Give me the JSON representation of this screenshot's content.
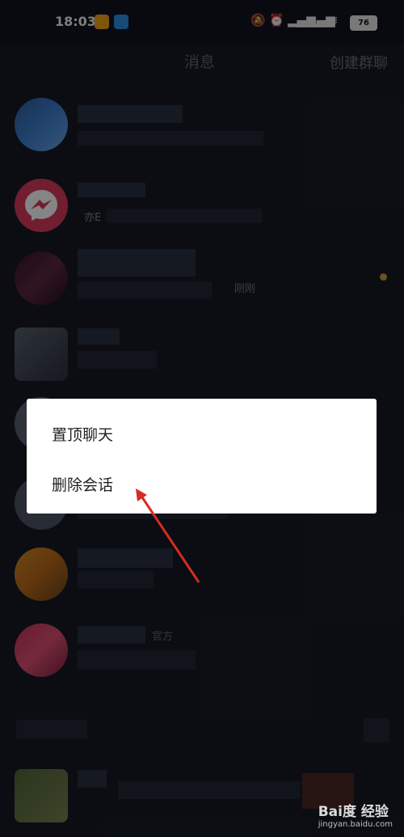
{
  "status_bar": {
    "time": "18:03",
    "battery": "76"
  },
  "header": {
    "title": "消息",
    "create_group": "创建群聊"
  },
  "rows": [
    {
      "snippet": "",
      "meta": ""
    },
    {
      "snippet": "亦E",
      "meta": ""
    },
    {
      "snippet": "",
      "meta": "刚刚"
    },
    {
      "snippet": "",
      "meta": ""
    },
    {
      "snippet": "",
      "meta": ""
    },
    {
      "snippet": "",
      "meta": ""
    },
    {
      "snippet": "",
      "meta": ""
    },
    {
      "snippet": "",
      "meta": "官方"
    }
  ],
  "context_menu": {
    "pin_chat": "置顶聊天",
    "delete_session": "删除会话"
  },
  "watermark": {
    "brand": "Bai度 经验",
    "url": "jingyan.baidu.com"
  },
  "colors": {
    "background": "#161a25",
    "menu_background": "#ffffff",
    "annotation_arrow": "#d62b22"
  }
}
